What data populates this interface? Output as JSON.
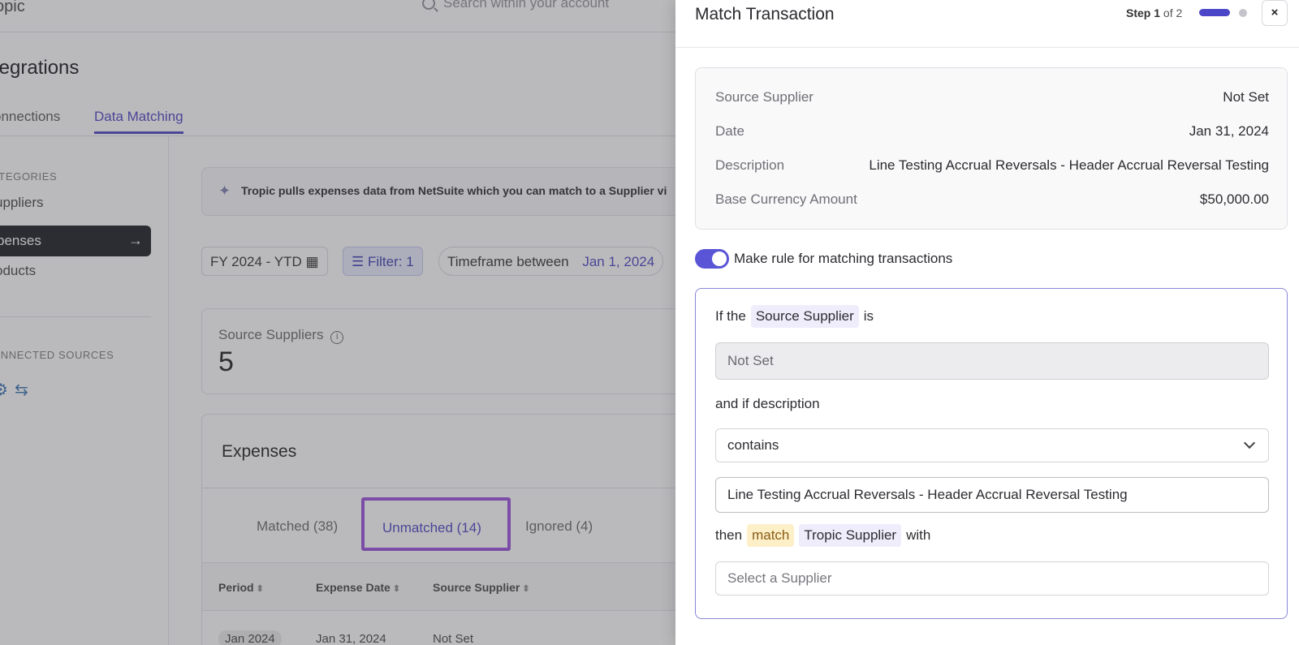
{
  "app": {
    "logo": "opic",
    "search_placeholder": "Search within your account",
    "page_title": "tegrations",
    "tabs": [
      "onnections",
      "Data Matching"
    ],
    "sidebar": {
      "categories_header": "ATEGORIES",
      "items": [
        "uppliers",
        "penses",
        "oducts"
      ],
      "active_item": "penses",
      "sources_header": "ONNECTED SOURCES"
    },
    "banner": "Tropic pulls expenses data from NetSuite which you can match to a Supplier vi",
    "filters": {
      "period": "FY 2024 - YTD",
      "filter": "Filter: 1",
      "timeframe_label": "Timeframe between",
      "timeframe_date": "Jan 1, 2024"
    },
    "source_suppliers": {
      "label": "Source Suppliers",
      "value": "5"
    },
    "expenses": {
      "title": "Expenses",
      "tabs": {
        "matched": "Matched (38)",
        "unmatched": "Unmatched (14)",
        "ignored": "Ignored (4)"
      },
      "columns": [
        "Period",
        "Expense Date",
        "Source Supplier"
      ],
      "first_row": [
        "Jan 2024",
        "Jan 31, 2024",
        "Not Set"
      ]
    }
  },
  "drawer": {
    "title": "Match Transaction",
    "step_word": "Step",
    "step_current": "1",
    "step_of": "of 2",
    "close_label": "×",
    "details": [
      {
        "label": "Source Supplier",
        "value": "Not Set"
      },
      {
        "label": "Date",
        "value": "Jan 31, 2024"
      },
      {
        "label": "Description",
        "value": "Line Testing Accrual Reversals - Header Accrual Reversal Testing"
      },
      {
        "label": "Base Currency Amount",
        "value": "$50,000.00"
      }
    ],
    "toggle": {
      "label": "Make rule for matching transactions",
      "on": true
    },
    "rule": {
      "if_the": "If the",
      "source_supplier_tag": "Source Supplier",
      "is": "is",
      "source_value": "Not Set",
      "and_if_description": "and if description",
      "operator": "contains",
      "description_value": "Line Testing Accrual Reversals - Header Accrual Reversal Testing",
      "then": "then",
      "match_tag": "match",
      "tropic_supplier_tag": "Tropic Supplier",
      "with": "with",
      "supplier_placeholder": "Select a Supplier"
    }
  },
  "colors": {
    "accent": "#5a55d6",
    "highlight_outline": "#a35fe0",
    "match_tag_bg": "#fdf0c9"
  }
}
